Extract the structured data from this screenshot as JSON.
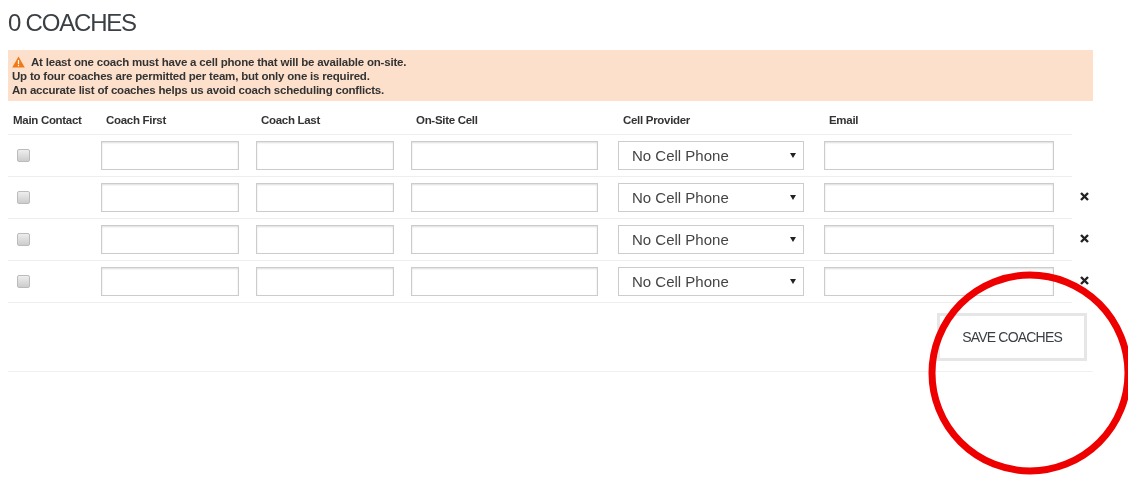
{
  "title": "0 COACHES",
  "alert": {
    "lines": [
      "At least one coach must have a cell phone that will be available on-site.",
      "Up to four coaches are permitted per team, but only one is required.",
      "An accurate list of coaches helps us avoid coach scheduling conflicts."
    ]
  },
  "table": {
    "columns": [
      "Main Contact",
      "Coach First",
      "Coach Last",
      "On-Site Cell",
      "Cell Provider",
      "Email"
    ],
    "rows": [
      {
        "main_contact": false,
        "cell_provider": "No Cell Phone",
        "removable": false
      },
      {
        "main_contact": false,
        "cell_provider": "No Cell Phone",
        "removable": true
      },
      {
        "main_contact": false,
        "cell_provider": "No Cell Phone",
        "removable": true
      },
      {
        "main_contact": false,
        "cell_provider": "No Cell Phone",
        "removable": true
      }
    ]
  },
  "save_button": "SAVE COACHES",
  "annotation": {
    "kind": "circle"
  }
}
